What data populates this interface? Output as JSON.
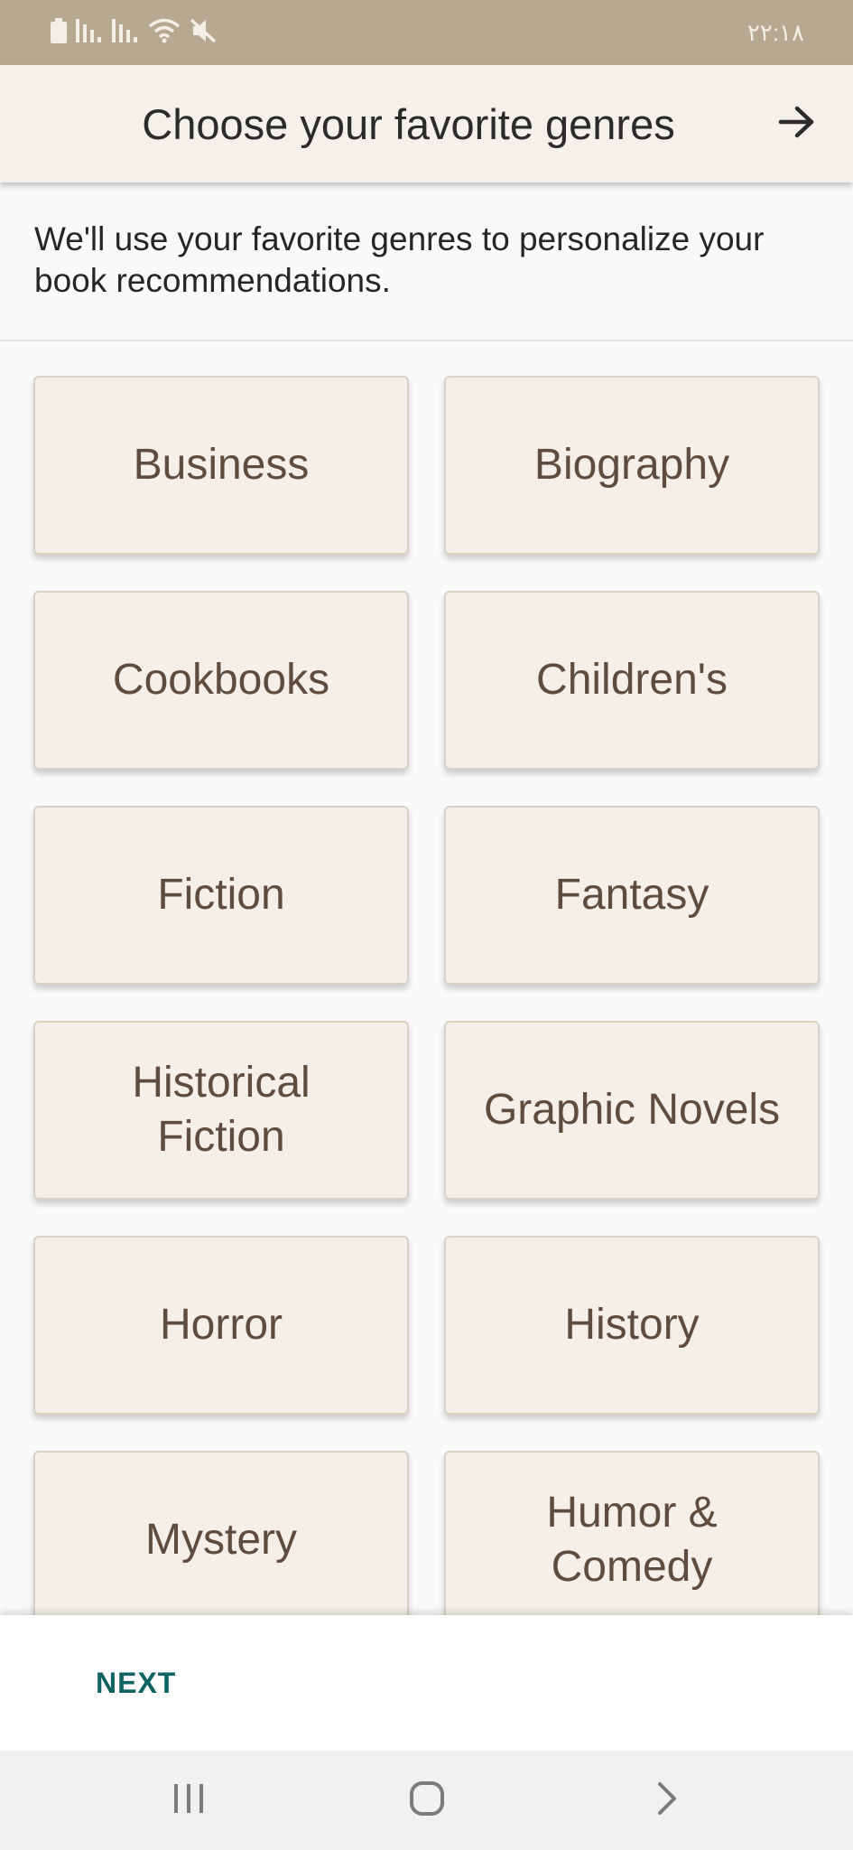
{
  "status_bar": {
    "time": "٢٢:١٨",
    "icons": [
      "battery-icon",
      "signal-icon",
      "signal-icon",
      "wifi-icon",
      "mute-icon"
    ]
  },
  "header": {
    "title": "Choose your favorite genres",
    "forward_icon": "arrow-right-icon"
  },
  "description": "We'll use your favorite genres to personalize your book recommendations.",
  "genres": [
    "Business",
    "Biography",
    "Cookbooks",
    "Children's",
    "Fiction",
    "Fantasy",
    "Historical Fiction",
    "Graphic Novels",
    "Horror",
    "History",
    "Mystery",
    "Humor & Comedy"
  ],
  "footer": {
    "next_label": "NEXT"
  },
  "nav_bar": {
    "icons": [
      "recent-apps-icon",
      "home-icon",
      "back-icon"
    ]
  },
  "colors": {
    "status_bar": "#b7a991",
    "app_bar": "#f4f1ea",
    "card_background": "#f4f0e9",
    "card_text": "#5f4c3e",
    "accent": "#0d6462"
  }
}
